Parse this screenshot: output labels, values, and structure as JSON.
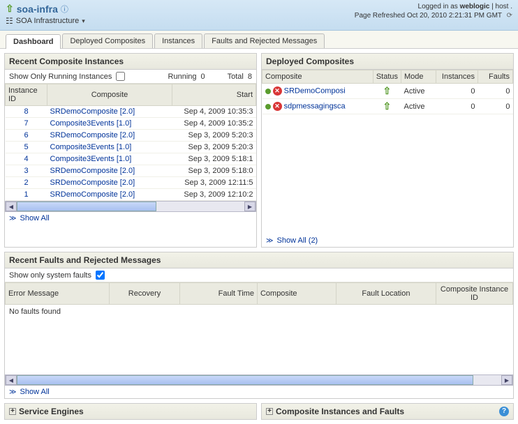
{
  "header": {
    "up_label": "soa-infra",
    "subtitle": "SOA Infrastructure",
    "login_prefix": "Logged in as ",
    "login_user": "weblogic",
    "login_host": "host .",
    "refresh_label": "Page Refreshed Oct 20, 2010 2:21:31 PM GMT"
  },
  "tabs": [
    "Dashboard",
    "Deployed Composites",
    "Instances",
    "Faults and Rejected Messages"
  ],
  "recent_instances": {
    "title": "Recent Composite Instances",
    "show_running_label": "Show Only Running Instances",
    "running_label": "Running",
    "running_count": "0",
    "total_label": "Total",
    "total_count": "8",
    "cols": [
      "Instance ID",
      "Composite",
      "Start"
    ],
    "rows": [
      {
        "id": "8",
        "comp": "SRDemoComposite [2.0]",
        "start": "Sep 4, 2009 10:35:3"
      },
      {
        "id": "7",
        "comp": "Composite3Events [1.0]",
        "start": "Sep 4, 2009 10:35:2"
      },
      {
        "id": "6",
        "comp": "SRDemoComposite [2.0]",
        "start": "Sep 3, 2009 5:20:3"
      },
      {
        "id": "5",
        "comp": "Composite3Events [1.0]",
        "start": "Sep 3, 2009 5:20:3"
      },
      {
        "id": "4",
        "comp": "Composite3Events [1.0]",
        "start": "Sep 3, 2009 5:18:1"
      },
      {
        "id": "3",
        "comp": "SRDemoComposite [2.0]",
        "start": "Sep 3, 2009 5:18:0"
      },
      {
        "id": "2",
        "comp": "SRDemoComposite [2.0]",
        "start": "Sep 3, 2009 12:11:5"
      },
      {
        "id": "1",
        "comp": "SRDemoComposite [2.0]",
        "start": "Sep 3, 2009 12:10:2"
      }
    ],
    "show_all": "Show All"
  },
  "deployed": {
    "title": "Deployed Composites",
    "cols": [
      "Composite",
      "Status",
      "Mode",
      "Instances",
      "Faults"
    ],
    "rows": [
      {
        "name": "SRDemoComposi",
        "mode": "Active",
        "instances": "0",
        "faults": "0"
      },
      {
        "name": "sdpmessagingsca",
        "mode": "Active",
        "instances": "0",
        "faults": "0"
      }
    ],
    "show_all": "Show All (2)"
  },
  "faults": {
    "title": "Recent Faults and Rejected Messages",
    "system_label": "Show only system faults",
    "cols": [
      "Error Message",
      "Recovery",
      "Fault Time",
      "Composite",
      "Fault Location",
      "Composite Instance ID"
    ],
    "empty": "No faults found",
    "show_all": "Show All"
  },
  "bottom": {
    "engines": "Service Engines",
    "instances_faults": "Composite Instances and Faults"
  }
}
